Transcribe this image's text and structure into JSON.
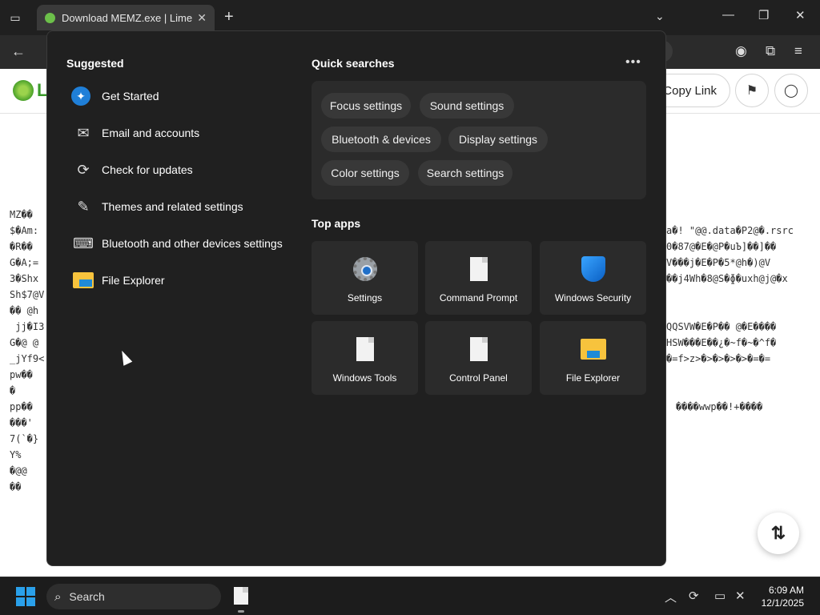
{
  "browser": {
    "tab_title": "Download MEMZ.exe | LimeWir",
    "tab_close": "✕",
    "new_tab": "+",
    "tab_dropdown": "⌄",
    "minimize": "—",
    "maximize": "❐",
    "close": "✕",
    "back": "←"
  },
  "page": {
    "logo_letter": "L",
    "copy_link": "Copy Link",
    "code_left": "MZ��\n$�Am:\n�R��\nG�A;=\n3�Shx\nSh$7@V\n�� @h\n jj�I3\nG�@ @\n_jYf9<\npw��\n�\npp��\n���'\n7(`�}\nY%\n�@@\n��",
    "code_right": "a�! \"@@.data�P2@�.rsrc\n0�87@�E�@P�uЪ]��]��\nV���j�E�P�5*@h�)@V\n��j4Wh�8@S�ɸ�uxh@j@�x\n\n\nQQSVW�E�P�� @�E����\nHSW���E��¿�~f�~�^f�\n�=f>z>�>�>�>�>�=�=",
    "code_right2": "����wwp��!+����"
  },
  "flyout": {
    "suggested_title": "Suggested",
    "suggested": [
      {
        "label": "Get Started",
        "icon": "get-started-icon"
      },
      {
        "label": "Email and accounts",
        "icon": "mail-icon"
      },
      {
        "label": "Check for updates",
        "icon": "refresh-icon"
      },
      {
        "label": "Themes and related settings",
        "icon": "brush-icon"
      },
      {
        "label": "Bluetooth and other devices settings",
        "icon": "devices-icon"
      },
      {
        "label": "File Explorer",
        "icon": "folder-icon"
      }
    ],
    "quick_title": "Quick searches",
    "more": "•••",
    "quick_searches": [
      "Focus settings",
      "Sound settings",
      "Bluetooth & devices",
      "Display settings",
      "Color settings",
      "Search settings"
    ],
    "top_apps_title": "Top apps",
    "top_apps": [
      {
        "label": "Settings",
        "icon": "settings-icon"
      },
      {
        "label": "Command Prompt",
        "icon": "document-icon"
      },
      {
        "label": "Windows Security",
        "icon": "shield-icon"
      },
      {
        "label": "Windows Tools",
        "icon": "document-icon"
      },
      {
        "label": "Control Panel",
        "icon": "document-icon"
      },
      {
        "label": "File Explorer",
        "icon": "folder-icon"
      }
    ]
  },
  "taskbar": {
    "search_placeholder": "Search",
    "time": "6:09 AM",
    "date": "12/1/2025"
  },
  "colors": {
    "accent": "#2aa0ea",
    "flyout_bg": "#202020",
    "tile_bg": "#2b2b2b",
    "chip_bg": "#383838"
  }
}
